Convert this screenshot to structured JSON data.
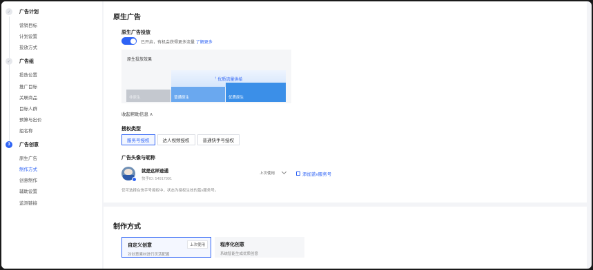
{
  "sidebar": {
    "groups": [
      {
        "marker": "✓",
        "label": "广告计划",
        "items": [
          "营销目标",
          "计划设置",
          "投放方式"
        ]
      },
      {
        "marker": "✓",
        "label": "广告组",
        "items": [
          "投放位置",
          "推广目标",
          "关联商品",
          "目标人群",
          "预算与出价",
          "组名称"
        ]
      },
      {
        "marker": "3",
        "label": "广告创意",
        "items": [
          "原生广告",
          "制作方式",
          "创意制作",
          "辅助设置",
          "监测链接"
        ]
      }
    ],
    "active_item": "制作方式"
  },
  "native_ad": {
    "section_title": "原生广告",
    "delivery_label": "原生广告投放",
    "toggle_on": true,
    "toggle_text": "已开启，有机会获得更多流量",
    "learn_more": "了解更多",
    "effect_title": "原生投放效果",
    "effect_bars": [
      "非原生",
      "普通原生",
      "优质原生"
    ],
    "effect_top": "优质流量供给",
    "collapse_text": "收起帮助信息 ∧"
  },
  "auth": {
    "label": "授权类型",
    "tabs": [
      "服务号授权",
      "达人视频授权",
      "普通快手号授权"
    ],
    "active_tab": 0
  },
  "avatar_section": {
    "label": "广告头像与昵称",
    "account_name": "就是这样速通",
    "account_id": "快手ID: 54917991",
    "last_used": "上次使用",
    "add_link": "添加蓝v服务号",
    "tip": "仅可选择在快手号授权中，状态为授权生效的蓝v服务号。"
  },
  "production": {
    "section_title": "制作方式",
    "methods": [
      {
        "title": "自定义创意",
        "desc": "对创意素材进行灵活配置",
        "badge": "上次使用",
        "selected": true
      },
      {
        "title": "程序化创意",
        "desc": "系统智能生成优质创意",
        "badge": "",
        "selected": false
      }
    ]
  }
}
